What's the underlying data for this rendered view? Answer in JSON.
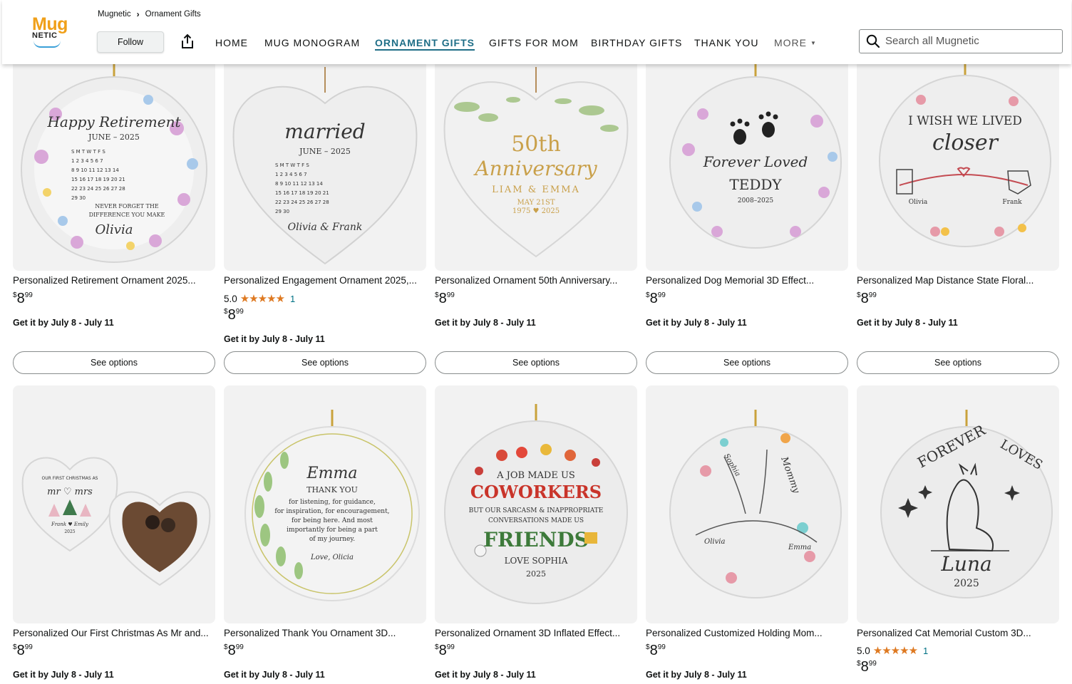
{
  "store": {
    "logo_top": "Mug",
    "logo_bottom": "NETIC",
    "name": "Mugnetic"
  },
  "breadcrumb": [
    "Mugnetic",
    "Ornament Gifts"
  ],
  "follow_label": "Follow",
  "nav": [
    {
      "label": "HOME",
      "active": false
    },
    {
      "label": "MUG MONOGRAM",
      "active": false
    },
    {
      "label": "ORNAMENT GIFTS",
      "active": true
    },
    {
      "label": "GIFTS FOR MOM",
      "active": false
    },
    {
      "label": "BIRTHDAY GIFTS",
      "active": false
    },
    {
      "label": "THANK YOU",
      "active": false
    },
    {
      "label": "MORE",
      "active": false
    }
  ],
  "search": {
    "placeholder": "Search all Mugnetic"
  },
  "colors": {
    "accent": "#1f6e87",
    "star": "#de7921",
    "link": "#007185"
  },
  "products_row1": [
    {
      "title": "Personalized Retirement Ornament 2025...",
      "price_symbol": "$",
      "price_whole": "8",
      "price_frac": "99",
      "delivery": "Get it by July 8 - July 11",
      "button": "See options",
      "art": {
        "shape": "circle",
        "l1": "Happy Retirement",
        "l2": "JUNE – 2025",
        "l3": "NEVER FORGET THE",
        "l4": "DIFFERENCE YOU MAKE",
        "l5": "Olivia"
      }
    },
    {
      "title": "Personalized Engagement Ornament 2025,...",
      "rating": "5.0",
      "stars": "★★★★★",
      "reviews": "1",
      "price_symbol": "$",
      "price_whole": "8",
      "price_frac": "99",
      "delivery": "Get it by July 8 - July 11",
      "button": "See options",
      "art": {
        "shape": "heart",
        "l1": "married",
        "l2": "JUNE – 2025",
        "l3": "Olivia & Frank"
      }
    },
    {
      "title": "Personalized Ornament 50th Anniversary...",
      "price_symbol": "$",
      "price_whole": "8",
      "price_frac": "99",
      "delivery": "Get it by July 8 - July 11",
      "button": "See options",
      "art": {
        "shape": "heart",
        "l1": "50th",
        "l2": "Anniversary",
        "l3": "LIAM & EMMA",
        "l4": "MAY 21ST",
        "l5": "1975 ♥ 2025"
      }
    },
    {
      "title": "Personalized Dog Memorial 3D Effect...",
      "price_symbol": "$",
      "price_whole": "8",
      "price_frac": "99",
      "delivery": "Get it by July 8 - July 11",
      "button": "See options",
      "art": {
        "shape": "circle",
        "l1": "Forever Loved",
        "l2": "TEDDY",
        "l3": "2008–2025"
      }
    },
    {
      "title": "Personalized Map Distance State Floral...",
      "price_symbol": "$",
      "price_whole": "8",
      "price_frac": "99",
      "delivery": "Get it by July 8 - July 11",
      "button": "See options",
      "art": {
        "shape": "circle",
        "l1": "I WISH WE LIVED",
        "l2": "closer",
        "l3": "Olivia",
        "l4": "Frank"
      }
    }
  ],
  "products_row2": [
    {
      "title": "Personalized Our First Christmas As Mr and...",
      "price_symbol": "$",
      "price_whole": "8",
      "price_frac": "99",
      "delivery": "Get it by July 8 - July 11",
      "art": {
        "shape": "hearts",
        "l1": "OUR FIRST CHRISTMAS AS",
        "l2": "mr ♡ mrs",
        "l3": "Frank ♥ Emily",
        "l4": "2025"
      }
    },
    {
      "title": "Personalized Thank You Ornament 3D...",
      "price_symbol": "$",
      "price_whole": "8",
      "price_frac": "99",
      "delivery": "Get it by July 8 - July 11",
      "art": {
        "shape": "circle",
        "l1": "Emma",
        "l2": "THANK YOU",
        "l3": "for listening, for guidance,",
        "l4": "for inspiration, for encouragement,",
        "l5": "for being here. And most",
        "l6": "importantly for being a part",
        "l7": "of my journey.",
        "l8": "Love, Olicia"
      }
    },
    {
      "title": "Personalized Ornament 3D Inflated Effect...",
      "price_symbol": "$",
      "price_whole": "8",
      "price_frac": "99",
      "delivery": "Get it by July 8 - July 11",
      "art": {
        "shape": "circle",
        "l1": "A JOB MADE US",
        "l2": "COWORKERS",
        "l3": "BUT OUR SARCASM & INAPPROPRIATE",
        "l4": "CONVERSATIONS MADE US",
        "l5": "FRIENDS",
        "l6": "LOVE SOPHIA",
        "l7": "2025"
      }
    },
    {
      "title": "Personalized Customized Holding Mom...",
      "price_symbol": "$",
      "price_whole": "8",
      "price_frac": "99",
      "delivery": "Get it by July 8 - July 11",
      "art": {
        "shape": "circle",
        "l1": "Sophia",
        "l2": "Mommy",
        "l3": "Olivia",
        "l4": "Emma"
      }
    },
    {
      "title": "Personalized Cat Memorial Custom 3D...",
      "rating": "5.0",
      "stars": "★★★★★",
      "reviews": "1",
      "price_symbol": "$",
      "price_whole": "8",
      "price_frac": "99",
      "art": {
        "shape": "circle",
        "l1": "FOREVER",
        "l2": "LOVES",
        "l3": "Luna",
        "l4": "2025"
      }
    }
  ]
}
